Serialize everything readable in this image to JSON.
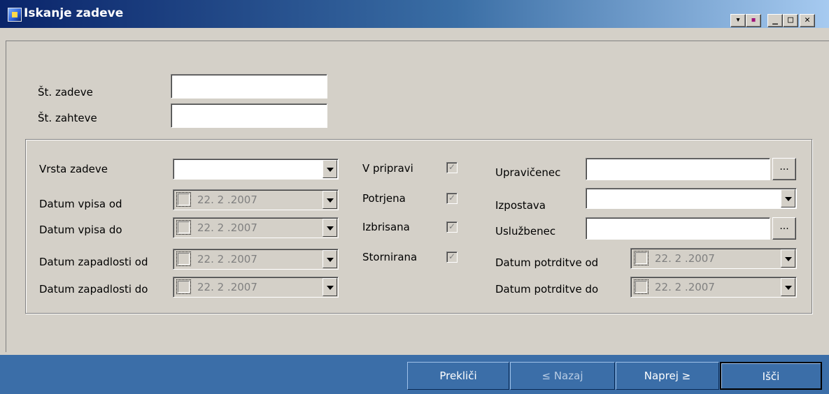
{
  "window": {
    "title": "Iskanje zadeve",
    "controls": [
      "▾",
      "▪",
      "_",
      "□",
      "✕"
    ]
  },
  "fields": {
    "st_zadeve_label": "Št. zadeve",
    "st_zadeve_value": "",
    "st_zahteve_label": "Št. zahteve",
    "st_zahteve_value": ""
  },
  "group": {
    "vrsta_zadeve": {
      "label": "Vrsta zadeve",
      "value": ""
    },
    "datum_vpisa_od": {
      "label": "Datum vpisa od",
      "value": "22. 2 .2007"
    },
    "datum_vpisa_do": {
      "label": "Datum vpisa do",
      "value": "22. 2 .2007"
    },
    "datum_zapadlosti_od": {
      "label": "Datum zapadlosti od",
      "value": "22. 2 .2007"
    },
    "datum_zapadlosti_do": {
      "label": "Datum zapadlosti do",
      "value": "22. 2 .2007"
    },
    "status_checks": [
      {
        "label": "V pripravi",
        "checked": true
      },
      {
        "label": "Potrjena",
        "checked": true
      },
      {
        "label": "Izbrisana",
        "checked": true
      },
      {
        "label": "Stornirana",
        "checked": true
      }
    ],
    "upravicenec": {
      "label": "Upravičenec",
      "value": "",
      "button": "..."
    },
    "izpostava": {
      "label": "Izpostava",
      "value": ""
    },
    "usluzbenec": {
      "label": "Uslužbenec",
      "value": "",
      "button": "..."
    },
    "datum_potrditve_od": {
      "label": "Datum potrditve od",
      "value": "22. 2 .2007"
    },
    "datum_potrditve_do": {
      "label": "Datum potrditve do",
      "value": "22. 2 .2007"
    }
  },
  "buttons": {
    "preklici": "Prekliči",
    "nazaj": "≤ Nazaj",
    "naprej": "Naprej ≥",
    "isci": "Išči"
  }
}
